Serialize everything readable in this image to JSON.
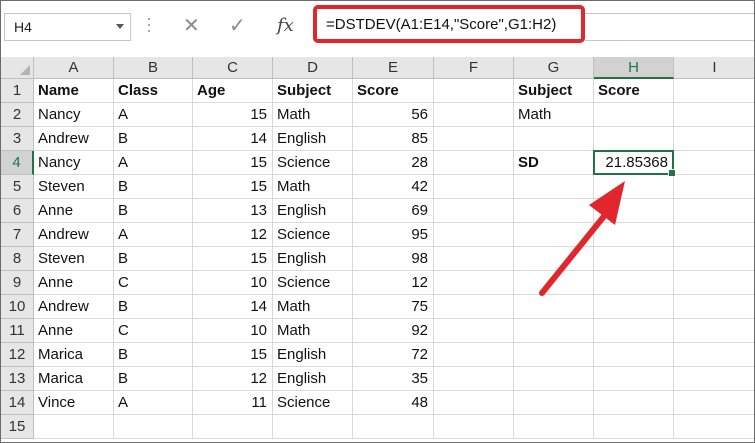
{
  "name_box": "H4",
  "formula": "=DSTDEV(A1:E14,\"Score\",G1:H2)",
  "icons": {
    "cancel": "x-icon",
    "enter": "check-icon",
    "function": "fx-icon"
  },
  "fx_label": "fx",
  "cancel_glyph": "✕",
  "enter_glyph": "✓",
  "selection_color": "#217346",
  "highlight_color": "#e0272e",
  "columns": [
    "A",
    "B",
    "C",
    "D",
    "E",
    "F",
    "G",
    "H",
    "I"
  ],
  "rows": [
    "1",
    "2",
    "3",
    "4",
    "5",
    "6",
    "7",
    "8",
    "9",
    "10",
    "11",
    "12",
    "13",
    "14",
    "15"
  ],
  "table": {
    "headers": [
      "Name",
      "Class",
      "Age",
      "Subject",
      "Score"
    ],
    "records": [
      [
        "Nancy",
        "A",
        "15",
        "Math",
        "56"
      ],
      [
        "Andrew",
        "B",
        "14",
        "English",
        "85"
      ],
      [
        "Nancy",
        "A",
        "15",
        "Science",
        "28"
      ],
      [
        "Steven",
        "B",
        "15",
        "Math",
        "42"
      ],
      [
        "Anne",
        "B",
        "13",
        "English",
        "69"
      ],
      [
        "Andrew",
        "A",
        "12",
        "Science",
        "95"
      ],
      [
        "Steven",
        "B",
        "15",
        "English",
        "98"
      ],
      [
        "Anne",
        "C",
        "10",
        "Science",
        "12"
      ],
      [
        "Andrew",
        "B",
        "14",
        "Math",
        "75"
      ],
      [
        "Anne",
        "C",
        "10",
        "Math",
        "92"
      ],
      [
        "Marica",
        "B",
        "15",
        "English",
        "72"
      ],
      [
        "Marica",
        "B",
        "12",
        "English",
        "35"
      ],
      [
        "Vince",
        "A",
        "11",
        "Science",
        "48"
      ]
    ]
  },
  "criteria": {
    "header_subject": "Subject",
    "header_score": "Score",
    "subject_value": "Math",
    "sd_label": "SD",
    "sd_value": "21.85368"
  }
}
